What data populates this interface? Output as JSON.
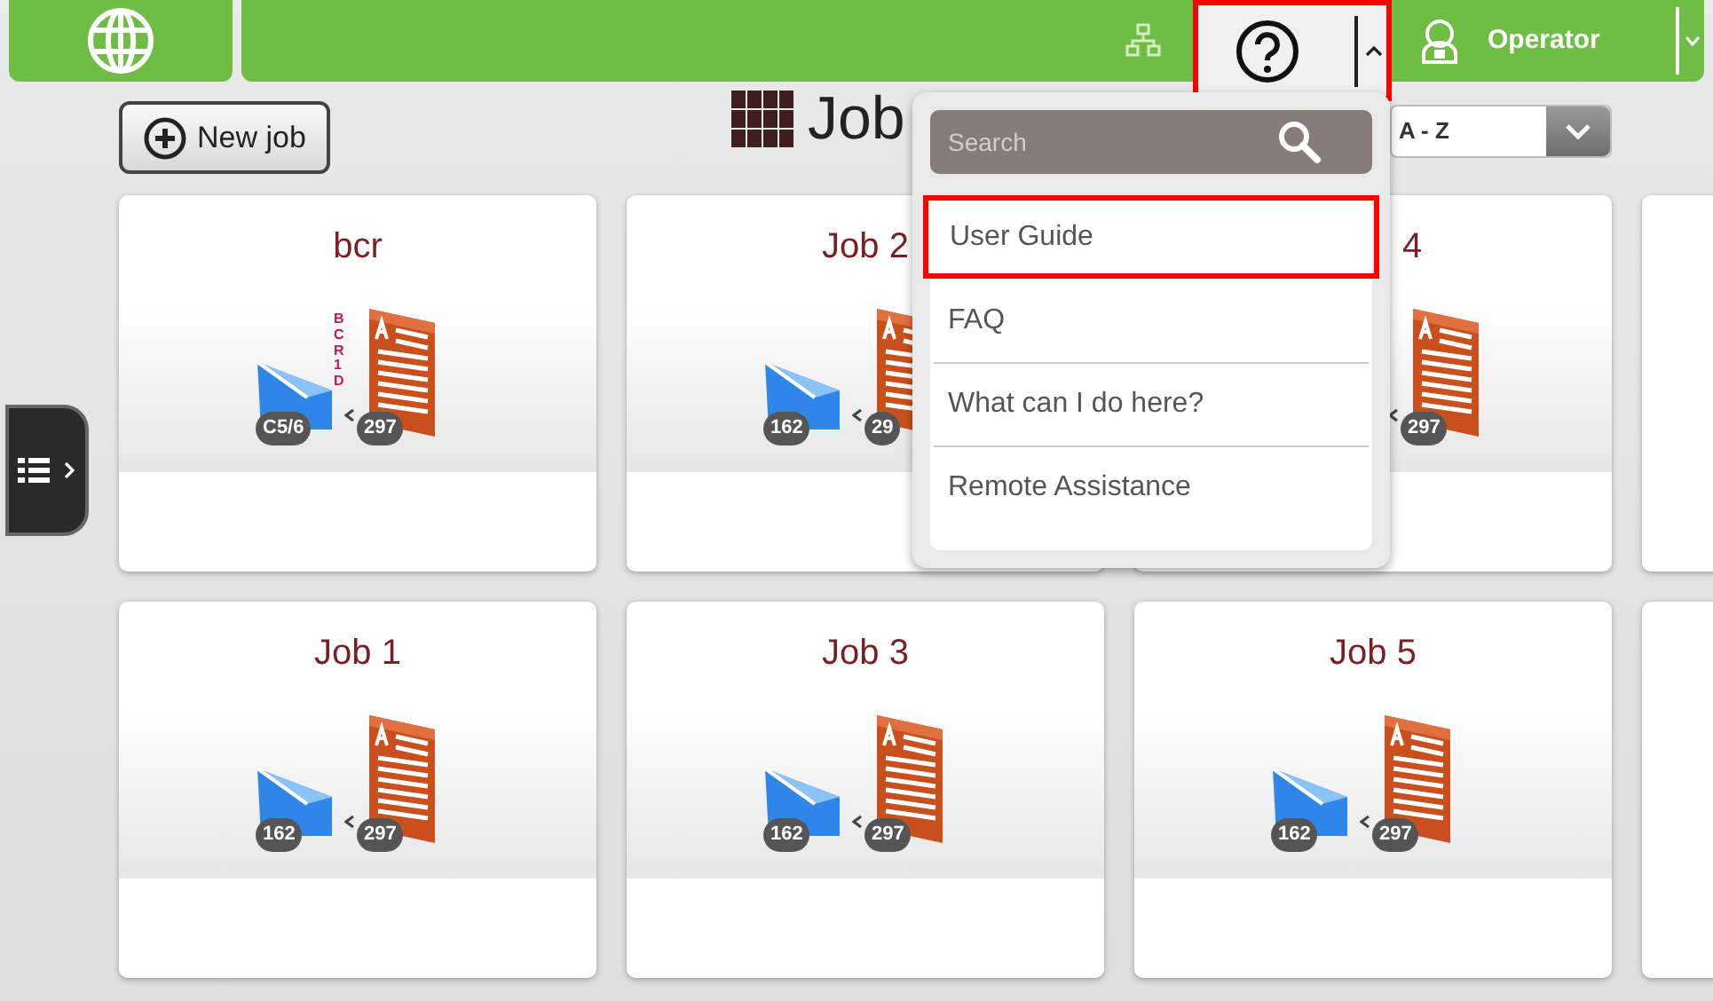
{
  "top_bar": {
    "help_button": {
      "highlighted": true,
      "expanded": true
    },
    "user": {
      "name": "Operator"
    }
  },
  "toolbar": {
    "new_job_button": "New job",
    "title": "Job",
    "sort": {
      "value": "A - Z"
    }
  },
  "help_menu": {
    "search": {
      "placeholder": "Search"
    },
    "items": [
      {
        "label": "User Guide",
        "highlighted": true
      },
      {
        "label": "FAQ",
        "highlighted": false
      },
      {
        "label": "What can I do here?",
        "highlighted": false
      },
      {
        "label": "Remote Assistance",
        "highlighted": false
      }
    ]
  },
  "job_rows": [
    [
      {
        "kind": "job",
        "title": "bcr",
        "envelope_badge": "C5/6",
        "document_badge": "297",
        "barcode_label": "BCR 1D"
      },
      {
        "kind": "job",
        "title": "Job 2",
        "envelope_badge": "162",
        "document_badge": "29"
      },
      {
        "kind": "job_partly_covered",
        "title": "4",
        "document_badge": "297"
      },
      {
        "kind": "cut_off"
      }
    ],
    [
      {
        "kind": "job",
        "title": "Job 1",
        "envelope_badge": "162",
        "document_badge": "297"
      },
      {
        "kind": "job",
        "title": "Job 3",
        "envelope_badge": "162",
        "document_badge": "297"
      },
      {
        "kind": "job",
        "title": "Job 5",
        "envelope_badge": "162",
        "document_badge": "297"
      },
      {
        "kind": "cut_off"
      }
    ]
  ]
}
